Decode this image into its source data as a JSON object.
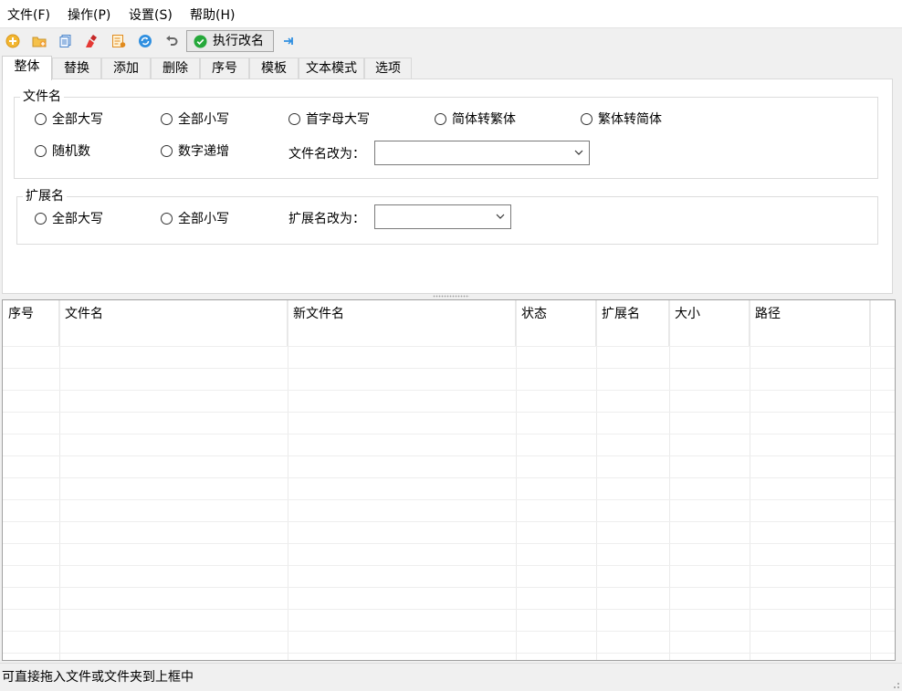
{
  "menu": {
    "items": [
      {
        "id": "file",
        "label": "文件(F)"
      },
      {
        "id": "operate",
        "label": "操作(P)"
      },
      {
        "id": "settings",
        "label": "设置(S)"
      },
      {
        "id": "help",
        "label": "帮助(H)"
      }
    ]
  },
  "toolbar": {
    "icons": [
      "add-file-icon",
      "add-folder-icon",
      "copy-icon",
      "clear-icon",
      "edit-list-icon",
      "refresh-icon",
      "undo-icon"
    ],
    "execute_label": "执行改名",
    "pin_icon": "pin-icon"
  },
  "tabs": {
    "active": "整体",
    "items": [
      "整体",
      "替换",
      "添加",
      "删除",
      "序号",
      "模板",
      "文本模式",
      "选项"
    ]
  },
  "filename_group": {
    "title": "文件名",
    "options": [
      "全部大写",
      "全部小写",
      "首字母大写",
      "简体转繁体",
      "繁体转简体",
      "随机数",
      "数字递增"
    ],
    "rename_label": "文件名改为：",
    "rename_value": ""
  },
  "extension_group": {
    "title": "扩展名",
    "options": [
      "全部大写",
      "全部小写"
    ],
    "rename_label": "扩展名改为：",
    "rename_value": ""
  },
  "table": {
    "columns": [
      "序号",
      "文件名",
      "新文件名",
      "状态",
      "扩展名",
      "大小",
      "路径"
    ],
    "rows": []
  },
  "status": {
    "text": "可直接拖入文件或文件夹到上框中"
  },
  "colors": {
    "accent_green": "#25a83a",
    "window_bg": "#f0f0f0",
    "panel_bg": "#ffffff"
  }
}
